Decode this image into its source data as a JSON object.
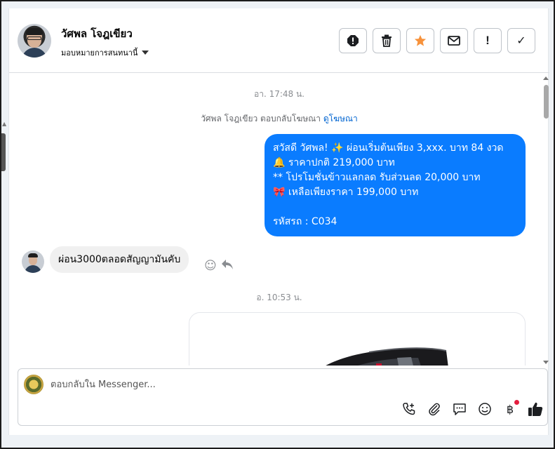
{
  "header": {
    "contact_name": "วัศพล โจฎเขียว",
    "assign_label": "มอบหมายการสนทนานี้",
    "actions": [
      {
        "name": "spam-icon",
        "glyph": "⚠"
      },
      {
        "name": "trash-icon",
        "glyph": "🗑"
      },
      {
        "name": "star-icon",
        "glyph": "★"
      },
      {
        "name": "envelope-icon",
        "glyph": "✉"
      },
      {
        "name": "exclamation-icon",
        "glyph": "!"
      },
      {
        "name": "check-icon",
        "glyph": "✓"
      }
    ]
  },
  "messages": {
    "timestamp_1": "อา. 17:48 น.",
    "ad_reply_text": "วัศพล โจฎเขียว ตอบกลับโฆษณา",
    "ad_link": "ดูโฆษณา",
    "outgoing_text": "สวัสดี วัศพล! ✨  ผ่อนเริ่มต้นเพียง 3,xxx. บาท 84 งวด\n🔔 ราคาปกติ 219,000 บาท\n** โปรโมชั่นข้าวแลกลด รับส่วนลด 20,000 บาท\n🎀  เหลือเพียงราคา 199,000 บาท\n\n รหัสรถ : C034",
    "incoming_text": "ผ่อน3000ตลอดสัญญามันคับ",
    "timestamp_2": "อ. 10:53 น."
  },
  "composer": {
    "placeholder": "ตอบกลับใน Messenger..."
  },
  "colors": {
    "outgoing_bubble": "#0a7cff",
    "incoming_bubble": "#f0f0f0",
    "star_active": "#f7923b",
    "link": "#0064d1"
  }
}
